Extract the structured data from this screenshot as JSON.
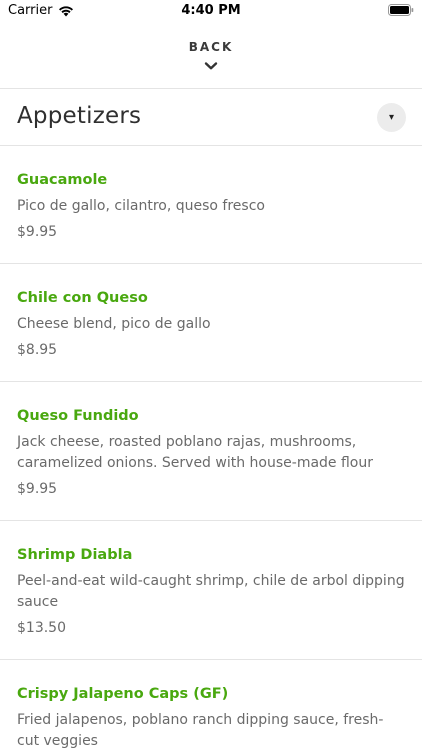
{
  "status_bar": {
    "carrier": "Carrier",
    "time": "4:40 PM"
  },
  "header": {
    "back_label": "BACK"
  },
  "section": {
    "title": "Appetizers",
    "toggle_glyph": "▾"
  },
  "menu": {
    "items": [
      {
        "name": "Guacamole",
        "description": "Pico de gallo, cilantro, queso fresco",
        "price": "$9.95"
      },
      {
        "name": "Chile con Queso",
        "description": "Cheese blend, pico de gallo",
        "price": "$8.95"
      },
      {
        "name": "Queso Fundido",
        "description": "Jack cheese, roasted poblano rajas, mushrooms, caramelized onions. Served with house-made flour",
        "price": "$9.95"
      },
      {
        "name": "Shrimp Diabla",
        "description": "Peel-and-eat wild-caught shrimp, chile de arbol dipping sauce",
        "price": "$13.50"
      },
      {
        "name": "Crispy Jalapeno Caps (GF)",
        "description": "Fried jalapenos, poblano ranch dipping sauce, fresh-cut veggies",
        "price": ""
      }
    ]
  },
  "colors": {
    "item_name": "#49a80f",
    "body_text": "#6a6a6a",
    "divider": "#e4e4e4"
  }
}
